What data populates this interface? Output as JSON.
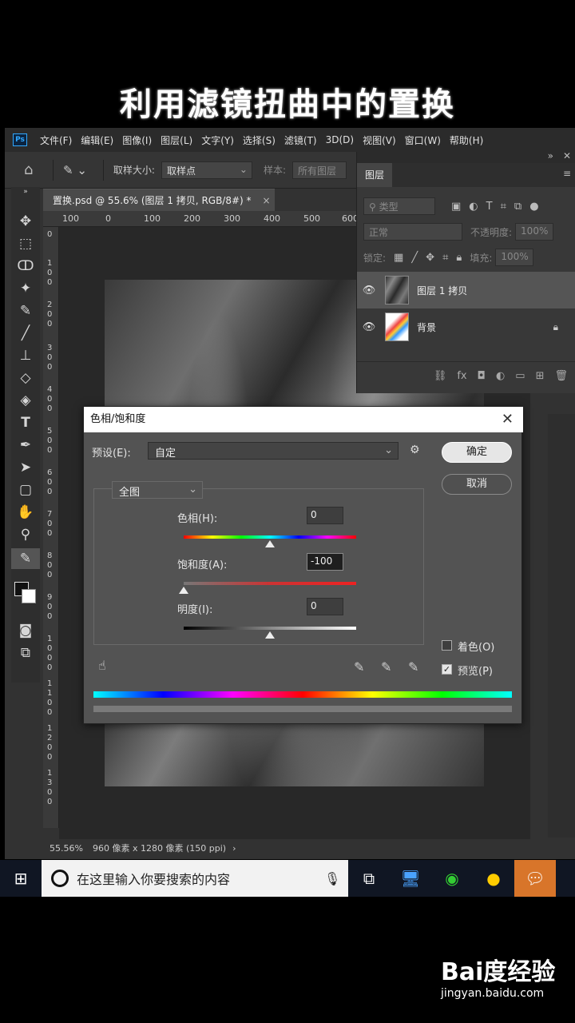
{
  "title": "利用滤镜扭曲中的置换",
  "app": {
    "logo": "Ps",
    "menu": [
      "文件(F)",
      "编辑(E)",
      "图像(I)",
      "图层(L)",
      "文字(Y)",
      "选择(S)",
      "滤镜(T)",
      "3D(D)",
      "视图(V)",
      "窗口(W)",
      "帮助(H)"
    ]
  },
  "options": {
    "sample_size_label": "取样大小:",
    "sample_size_value": "取样点",
    "sample_label": "样本:",
    "sample_value": "所有图层"
  },
  "document": {
    "tab_title": "置换.psd @ 55.6% (图层 1 拷贝, RGB/8#) *",
    "close": "×",
    "ruler_h": [
      "100",
      "0",
      "100",
      "200",
      "300",
      "400",
      "500",
      "600"
    ],
    "ruler_v": [
      "0",
      "1\n0\n0",
      "2\n0\n0",
      "3\n0\n0",
      "4\n0\n0",
      "5\n0\n0",
      "6\n0\n0",
      "7\n0\n0",
      "8\n0\n0",
      "9\n0\n0",
      "1\n0\n0\n0",
      "1\n1\n0\n0",
      "1\n2\n0\n0",
      "1\n3\n0\n0"
    ],
    "zoom": "55.56%",
    "doc_info": "960 像素 x 1280 像素 (150 ppi)",
    "more": "›"
  },
  "layers_panel": {
    "tab": "图层",
    "filter_placeholder": "类型",
    "blend_mode": "正常",
    "opacity_label": "不透明度:",
    "opacity_value": "100%",
    "lock_label": "锁定:",
    "fill_label": "填充:",
    "fill_value": "100%",
    "layers": [
      {
        "name": "图层 1 拷贝",
        "visible": true,
        "selected": true
      },
      {
        "name": "背景",
        "visible": true,
        "selected": false,
        "locked": true
      }
    ]
  },
  "dialog": {
    "title": "色相/饱和度",
    "close": "✕",
    "preset_label": "预设(E):",
    "preset_value": "自定",
    "ok": "确定",
    "cancel": "取消",
    "channel": "全图",
    "hue_label": "色相(H):",
    "hue_value": "0",
    "saturation_label": "饱和度(A):",
    "saturation_value": "-100",
    "lightness_label": "明度(I):",
    "lightness_value": "0",
    "colorize_label": "着色(O)",
    "colorize_checked": false,
    "preview_label": "预览(P)",
    "preview_checked": true,
    "hue_position": 0.5,
    "saturation_position": 0.0,
    "lightness_position": 0.5
  },
  "taskbar": {
    "search_placeholder": "在这里输入你要搜索的内容"
  },
  "watermark": {
    "brand": "Bai度经验",
    "url": "jingyan.baidu.com"
  }
}
